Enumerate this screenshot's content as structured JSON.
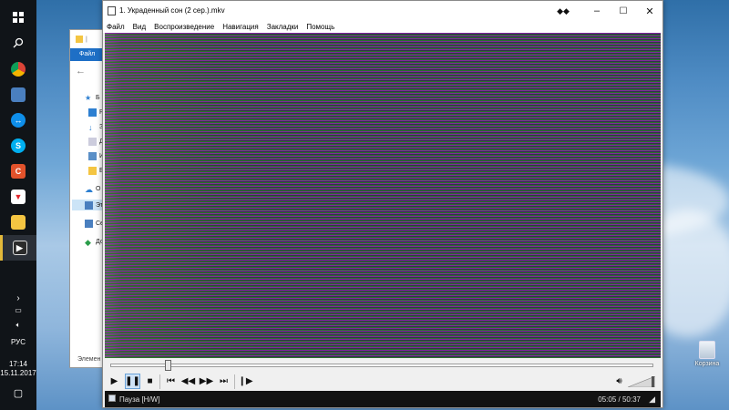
{
  "player": {
    "title": "1. Украденный сон (2 сер.).mkv",
    "menu": [
      "Файл",
      "Вид",
      "Воспроизведение",
      "Навигация",
      "Закладки",
      "Помощь"
    ],
    "status": "Пауза [H/W]",
    "time": "05:05 / 50:37",
    "progress_fraction": 0.1,
    "controls": [
      "play-icon",
      "pause-icon",
      "stop-icon",
      "skip-back-icon",
      "rewind-icon",
      "forward-icon",
      "skip-forward-icon",
      "frame-step-icon"
    ]
  },
  "explorer": {
    "ribbon_tab": "Файл",
    "items": [
      "Б",
      "Р",
      "З",
      "Д",
      "И",
      "Е",
      "О",
      "Эт",
      "Се",
      "До"
    ],
    "status": "Элемен"
  },
  "taskbar": {
    "language": "РУС",
    "time": "17:14",
    "date": "15.11.2017"
  },
  "desktop": {
    "recycle_bin_label": "Корзина"
  },
  "colors": {
    "taskbar": "#101418",
    "explorer_ribbon": "#1e6fc6",
    "video_purple": "#8c28aa",
    "video_green": "#287828",
    "status_bar": "#121212"
  }
}
